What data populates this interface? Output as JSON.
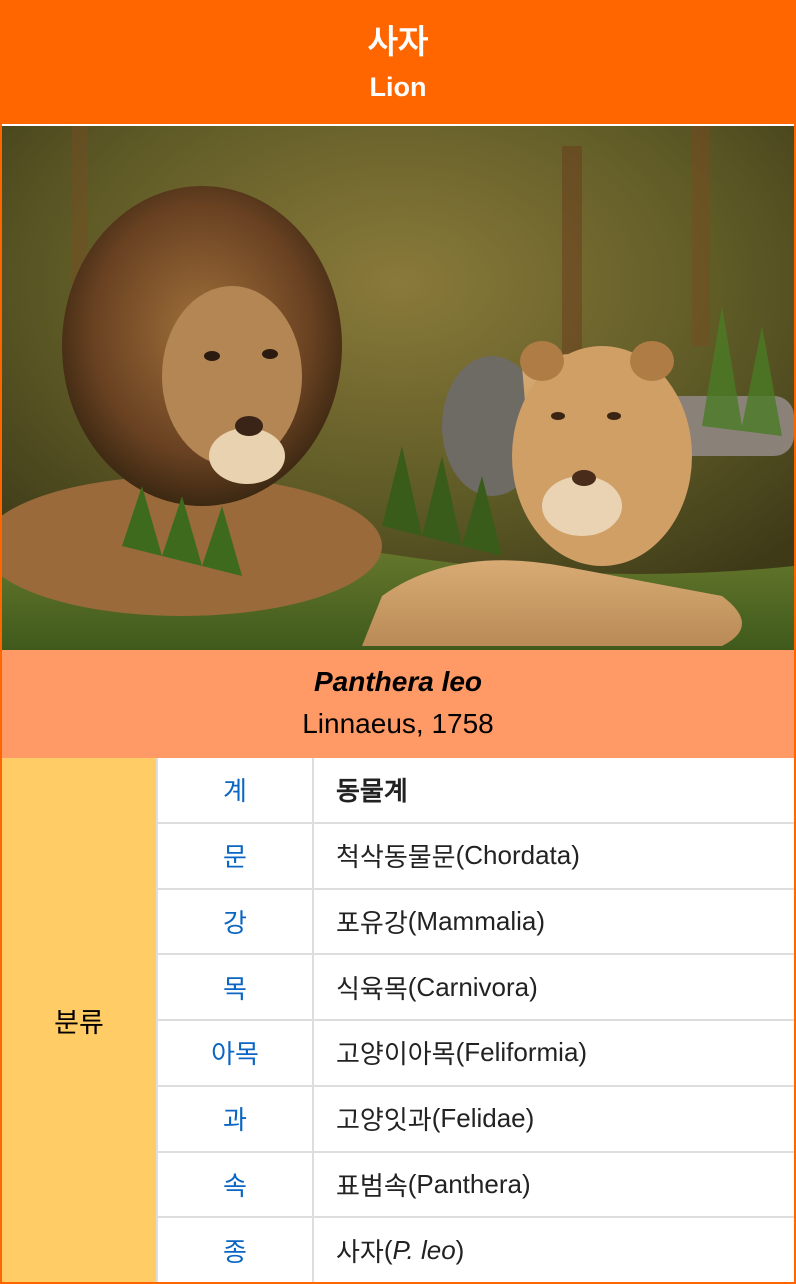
{
  "header": {
    "title_ko": "사자",
    "title_en": "Lion"
  },
  "photo": {
    "alt": "two lions resting on grass"
  },
  "scientific": {
    "binomial": "Panthera leo",
    "authority": "Linnaeus, 1758"
  },
  "taxonomy": {
    "section_label": "분류",
    "rows": [
      {
        "rank": "계",
        "ko": "동물계",
        "latin": ""
      },
      {
        "rank": "문",
        "ko": "척삭동물문",
        "latin": "(Chordata)"
      },
      {
        "rank": "강",
        "ko": "포유강",
        "latin": "(Mammalia)"
      },
      {
        "rank": "목",
        "ko": "식육목",
        "latin": "(Carnivora)"
      },
      {
        "rank": "아목",
        "ko": "고양이아목",
        "latin": "(Feliformia)"
      },
      {
        "rank": "과",
        "ko": "고양잇과",
        "latin": "(Felidae)"
      },
      {
        "rank": "속",
        "ko": "표범속",
        "latin": "(Panthera)"
      },
      {
        "rank": "종",
        "ko": "사자",
        "latin_open": "(",
        "latin_italic": "P. leo",
        "latin_close": ")"
      }
    ]
  },
  "colors": {
    "header": "#ff6600",
    "scientific": "#ff9966",
    "taxonomy_label": "#ffcc66",
    "rank_link": "#0b66c3"
  }
}
